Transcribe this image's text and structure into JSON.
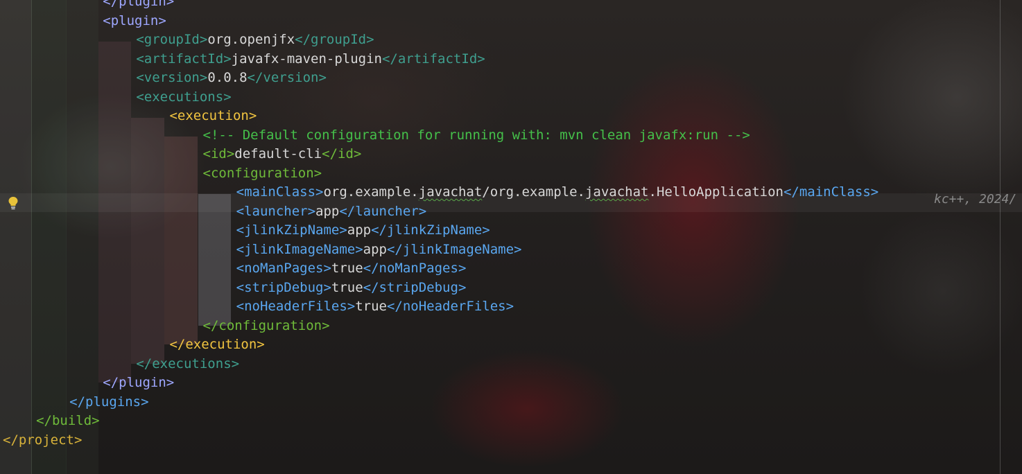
{
  "editor": {
    "lines": [
      {
        "indent": 6,
        "segments": [
          {
            "t": "</plugin>",
            "c": "lav"
          }
        ]
      },
      {
        "indent": 6,
        "segments": [
          {
            "t": "<plugin>",
            "c": "lav"
          }
        ]
      },
      {
        "indent": 8,
        "segments": [
          {
            "t": "<groupId>",
            "c": "green"
          },
          {
            "t": "org.openjfx",
            "c": "text"
          },
          {
            "t": "</groupId>",
            "c": "green"
          }
        ]
      },
      {
        "indent": 8,
        "segments": [
          {
            "t": "<artifactId>",
            "c": "green"
          },
          {
            "t": "javafx-maven-plugin",
            "c": "text"
          },
          {
            "t": "</artifactId>",
            "c": "green"
          }
        ]
      },
      {
        "indent": 8,
        "segments": [
          {
            "t": "<version>",
            "c": "green"
          },
          {
            "t": "0.0.8",
            "c": "text"
          },
          {
            "t": "</version>",
            "c": "green"
          }
        ]
      },
      {
        "indent": 8,
        "segments": [
          {
            "t": "<executions>",
            "c": "green"
          }
        ]
      },
      {
        "indent": 10,
        "segments": [
          {
            "t": "<execution>",
            "c": "gold"
          }
        ]
      },
      {
        "indent": 12,
        "segments": [
          {
            "t": "<!-- Default configuration for running with: mvn clean javafx:run -->",
            "c": "com"
          }
        ]
      },
      {
        "indent": 12,
        "segments": [
          {
            "t": "<id>",
            "c": "lime"
          },
          {
            "t": "default-cli",
            "c": "text"
          },
          {
            "t": "</id>",
            "c": "lime"
          }
        ]
      },
      {
        "indent": 12,
        "segments": [
          {
            "t": "<configuration>",
            "c": "lime"
          }
        ]
      },
      {
        "indent": 14,
        "segments": [
          {
            "t": "<mainClass>",
            "c": "blue"
          },
          {
            "t": "org.example.",
            "c": "text"
          },
          {
            "t": "javachat",
            "c": "text",
            "wavy": true
          },
          {
            "t": "/org.example.",
            "c": "text"
          },
          {
            "t": "javachat",
            "c": "text",
            "wavy": true
          },
          {
            "t": ".HelloApplication",
            "c": "text"
          },
          {
            "t": "</mainClass>",
            "c": "blue"
          }
        ]
      },
      {
        "indent": 14,
        "segments": [
          {
            "t": "<launcher>",
            "c": "blue"
          },
          {
            "t": "app",
            "c": "text"
          },
          {
            "t": "</launcher>",
            "c": "blue"
          }
        ]
      },
      {
        "indent": 14,
        "segments": [
          {
            "t": "<jlinkZipName>",
            "c": "blue"
          },
          {
            "t": "app",
            "c": "text"
          },
          {
            "t": "</jlinkZipName>",
            "c": "blue"
          }
        ]
      },
      {
        "indent": 14,
        "segments": [
          {
            "t": "<jlinkImageName>",
            "c": "blue"
          },
          {
            "t": "app",
            "c": "text"
          },
          {
            "t": "</jlinkImageName>",
            "c": "blue"
          }
        ]
      },
      {
        "indent": 14,
        "segments": [
          {
            "t": "<noManPages>",
            "c": "blue"
          },
          {
            "t": "true",
            "c": "text"
          },
          {
            "t": "</noManPages>",
            "c": "blue"
          }
        ]
      },
      {
        "indent": 14,
        "segments": [
          {
            "t": "<stripDebug>",
            "c": "blue"
          },
          {
            "t": "true",
            "c": "text"
          },
          {
            "t": "</stripDebug>",
            "c": "blue"
          }
        ]
      },
      {
        "indent": 14,
        "segments": [
          {
            "t": "<noHeaderFiles>",
            "c": "blue"
          },
          {
            "t": "true",
            "c": "text"
          },
          {
            "t": "</noHeaderFiles>",
            "c": "blue"
          }
        ]
      },
      {
        "indent": 12,
        "segments": [
          {
            "t": "</configuration>",
            "c": "lime"
          }
        ]
      },
      {
        "indent": 10,
        "segments": [
          {
            "t": "</execution>",
            "c": "gold"
          }
        ]
      },
      {
        "indent": 8,
        "segments": [
          {
            "t": "</executions>",
            "c": "green"
          }
        ]
      },
      {
        "indent": 6,
        "segments": [
          {
            "t": "</plugin>",
            "c": "lav"
          }
        ]
      },
      {
        "indent": 4,
        "segments": [
          {
            "t": "</plugins>",
            "c": "blue"
          }
        ]
      },
      {
        "indent": 2,
        "segments": [
          {
            "t": "</build>",
            "c": "lime"
          }
        ]
      },
      {
        "indent": 0,
        "segments": [
          {
            "t": "</project>",
            "c": "yell"
          }
        ]
      }
    ],
    "inlay_blame": "kc++, 2024/",
    "gutter_icon": "lightbulb-icon"
  }
}
